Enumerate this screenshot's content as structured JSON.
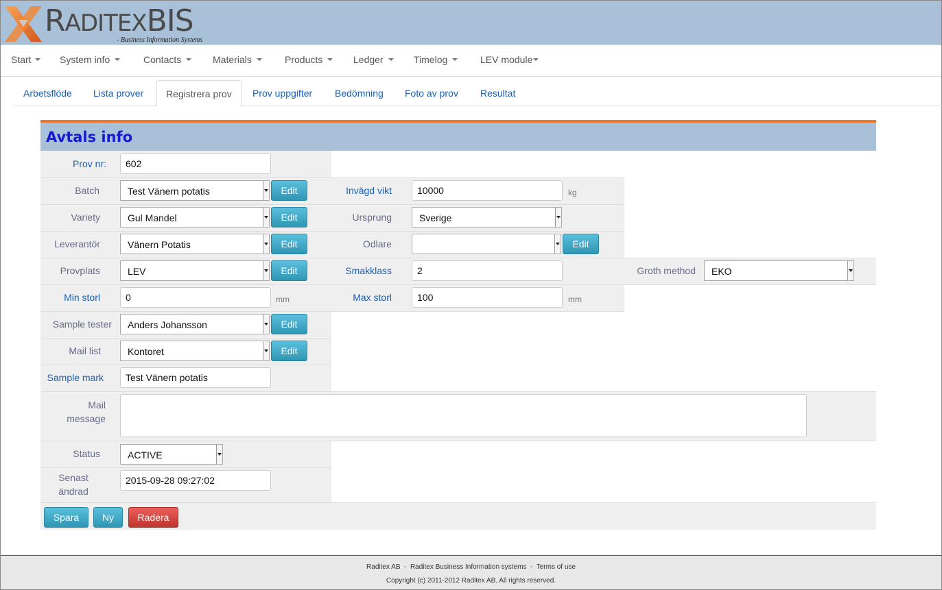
{
  "brand": {
    "name_big_1": "R",
    "name_small": "ADITEX",
    "name_big_2": "BIS",
    "tagline": "- Business Information Systems"
  },
  "menu": [
    {
      "label": "Start"
    },
    {
      "label": "System info"
    },
    {
      "label": "Contacts"
    },
    {
      "label": "Materials"
    },
    {
      "label": "Products"
    },
    {
      "label": "Ledger"
    },
    {
      "label": "Timelog"
    },
    {
      "label": "LEV module"
    }
  ],
  "tabs": [
    {
      "label": "Arbetsflöde"
    },
    {
      "label": "Lista prover"
    },
    {
      "label": "Registrera prov",
      "active": true
    },
    {
      "label": "Prov uppgifter"
    },
    {
      "label": "Bedömning"
    },
    {
      "label": "Foto av prov"
    },
    {
      "label": "Resultat"
    }
  ],
  "panel": {
    "title": "Avtals info",
    "accent_color": "#e8792e",
    "header_color": "#a8c0d8"
  },
  "form": {
    "prov_nr": {
      "label": "Prov nr:",
      "value": "602"
    },
    "batch": {
      "label": "Batch",
      "value": "Test Vänern potatis",
      "edit": "Edit"
    },
    "variety": {
      "label": "Variety",
      "value": "Gul Mandel",
      "edit": "Edit"
    },
    "leverantor": {
      "label": "Leverantör",
      "value": "Vänern Potatis",
      "edit": "Edit"
    },
    "provplats": {
      "label": "Provplats",
      "value": "LEV",
      "edit": "Edit"
    },
    "min_storl": {
      "label": "Min storl",
      "value": "0",
      "unit": "mm"
    },
    "sample_tester": {
      "label": "Sample tester",
      "value": "Anders Johansson",
      "edit": "Edit"
    },
    "mail_list": {
      "label": "Mail list",
      "value": "Kontoret",
      "edit": "Edit"
    },
    "sample_mark": {
      "label": "Sample mark",
      "value": "Test Vänern potatis"
    },
    "mail_message": {
      "label_1": "Mail",
      "label_2": "message",
      "value": ""
    },
    "status": {
      "label": "Status",
      "value": "ACTIVE"
    },
    "senast_andrad": {
      "label_1": "Senast",
      "label_2": "ändrad",
      "value": "2015-09-28 09:27:02"
    },
    "invagd_vikt": {
      "label": "Invägd vikt",
      "value": "10000",
      "unit": "kg"
    },
    "ursprung": {
      "label": "Ursprung",
      "value": "Sverige"
    },
    "odlare": {
      "label": "Odlare",
      "value": "",
      "edit": "Edit"
    },
    "smakklass": {
      "label": "Smakklass",
      "value": "2"
    },
    "max_storl": {
      "label": "Max storl",
      "value": "100",
      "unit": "mm"
    },
    "groth_method": {
      "label": "Groth method",
      "value": "EKO"
    }
  },
  "actions": {
    "save": "Spara",
    "new": "Ny",
    "delete": "Radera"
  },
  "footer": {
    "line1": "Raditex AB  -  Raditex Business Information systems  -  Terms of use",
    "line2": "Copyright (c) 2011-2012 Raditex AB. All rights reserved."
  }
}
